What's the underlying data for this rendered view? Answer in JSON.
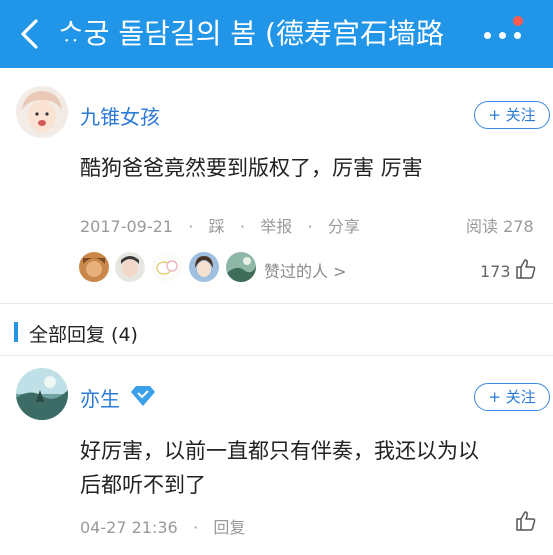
{
  "header": {
    "title": "ᄉᆢ궁 돌담길의 봄 (德寿宫石墙路",
    "back_icon": "chevron-left-icon",
    "more_icon": "more-dots-icon",
    "badge_color": "#ff5a4d",
    "bar_color": "#2196e8"
  },
  "post": {
    "author": "九锥女孩",
    "follow_label": "+ 关注",
    "content": "酷狗爸爸竟然要到版权了，厉害 厉害",
    "date": "2017-09-21",
    "dislike_label": "踩",
    "report_label": "举报",
    "share_label": "分享",
    "reads": "阅读 278",
    "likers_label": "赞过的人 >",
    "like_count": "173"
  },
  "replies_section": {
    "title": "全部回复 (4)"
  },
  "reply": {
    "author": "亦生",
    "follow_label": "+ 关注",
    "content_line1": "好厉害，以前一直都只有伴奏，我还以为以",
    "content_line2": "后都听不到了",
    "time": "04-27 21:36",
    "reply_label": "回复"
  }
}
